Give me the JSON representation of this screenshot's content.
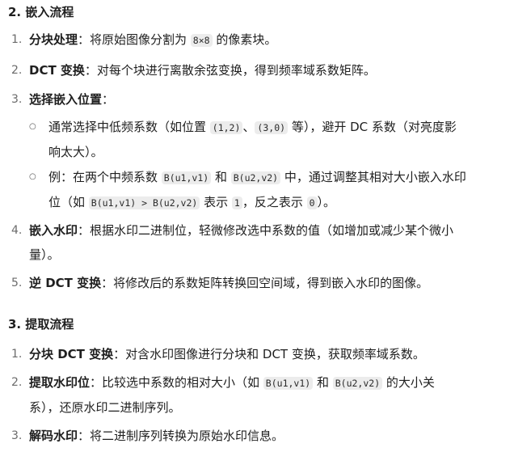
{
  "section2": {
    "title": "2. 嵌入流程",
    "items": [
      {
        "num": "1.",
        "bold": "分块处理",
        "text1": "：将原始图像分割为 ",
        "code1": "8×8",
        "text2": " 的像素块。"
      },
      {
        "num": "2.",
        "bold": "DCT 变换",
        "text1": "：对每个块进行离散余弦变换，得到频率域系数矩阵。"
      },
      {
        "num": "3.",
        "bold": "选择嵌入位置",
        "text1": "："
      },
      {
        "num": "4.",
        "bold": "嵌入水印",
        "text1": "：根据水印二进制位，轻微修改选中系数的值（如增加或减少某个微小",
        "text2": "量）。"
      },
      {
        "num": "5.",
        "bold": "逆 DCT 变换",
        "text1": "：将修改后的系数矩阵转换回空间域，得到嵌入水印的图像。"
      }
    ],
    "subitems": [
      {
        "t1": "通常选择中低频系数（如位置 ",
        "c1": "(1,2)",
        "t2": "、",
        "c2": "(3,0)",
        "t3": " 等），避开 DC 系数（对亮度影",
        "t4": "响太大）。"
      },
      {
        "t1": "例：在两个中频系数 ",
        "c1": "B(u1,v1)",
        "t2": " 和 ",
        "c2": "B(u2,v2)",
        "t3": " 中，通过调整其相对大小嵌入水印",
        "t4": "位（如 ",
        "c3": "B(u1,v1) > B(u2,v2)",
        "t5": " 表示 ",
        "c4": "1",
        "t6": "，反之表示 ",
        "c5": "0",
        "t7": "）。"
      }
    ]
  },
  "section3": {
    "title": "3. 提取流程",
    "items": [
      {
        "num": "1.",
        "bold": "分块 DCT 变换",
        "text1": "：对含水印图像进行分块和 DCT 变换，获取频率域系数。"
      },
      {
        "num": "2.",
        "bold": "提取水印位",
        "text1": "：比较选中系数的相对大小（如 ",
        "code1": "B(u1,v1)",
        "text2": " 和 ",
        "code2": "B(u2,v2)",
        "text3": " 的大小关",
        "text4": "系），还原水印二进制序列。"
      },
      {
        "num": "3.",
        "bold": "解码水印",
        "text1": "：将二进制序列转换为原始水印信息。"
      }
    ]
  }
}
